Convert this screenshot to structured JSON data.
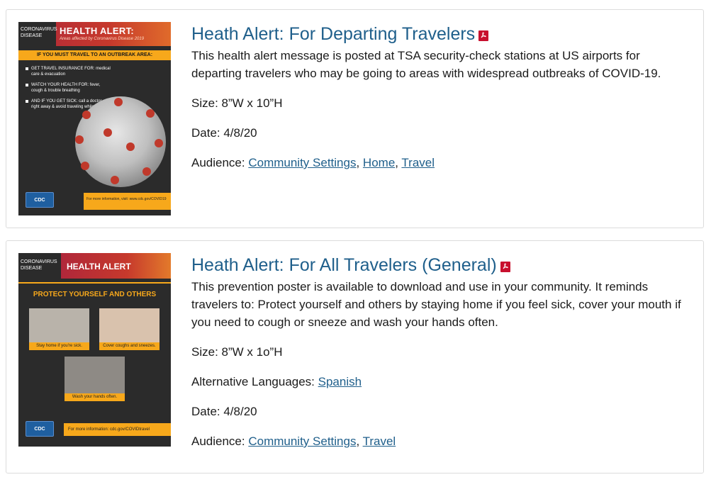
{
  "items": [
    {
      "title": "Heath Alert: For Departing Travelers",
      "description": "This health alert message is posted at TSA security-check stations at US airports for departing travelers who may be going to areas with widespread outbreaks of COVID-19.",
      "size_label": "Size: 8”W x 10”H",
      "date_label": "Date: 4/8/20",
      "audience_label": "Audience: ",
      "audience_links": [
        "Community Settings",
        "Home",
        "Travel"
      ],
      "poster": {
        "corner": "CORONAVIRUS DISEASE",
        "header": "HEALTH ALERT:",
        "subheader": "Areas affected by Coronavirus Disease 2019",
        "band": "IF YOU MUST TRAVEL TO AN OUTBREAK AREA:",
        "bullets": [
          "GET TRAVEL INSURANCE FOR: medical care & evacuation",
          "WATCH YOUR HEALTH FOR: fever, cough & trouble breathing",
          "AND IF YOU GET SICK: call a doctor right away & avoid traveling while sick"
        ],
        "footer": "For more information, visit: www.cdc.gov/COVID19",
        "logo": "CDC"
      }
    },
    {
      "title": "Heath Alert: For All Travelers (General)",
      "description": "This prevention poster is available to download and use in your community. It reminds travelers to: Protect yourself and others by staying home if you feel sick, cover your mouth if you need to cough or sneeze and wash your hands often.",
      "size_label": "Size: 8”W x 1o”H",
      "alt_lang_label": "Alternative Languages: ",
      "alt_lang_link": "Spanish",
      "date_label": "Date: 4/8/20",
      "audience_label": "Audience: ",
      "audience_links": [
        "Community Settings",
        "Travel"
      ],
      "poster": {
        "corner": "CORONAVIRUS DISEASE",
        "header": "HEALTH ALERT",
        "heading": "PROTECT YOURSELF AND OTHERS",
        "captions": [
          "Stay home if you're sick.",
          "Cover coughs and sneezes.",
          "Wash your hands often."
        ],
        "footer": "For more information: cdc.gov/COVIDtravel",
        "logo": "CDC"
      }
    }
  ],
  "colors": {
    "link": "#1f5f8b",
    "pdf_icon": "#c8102e",
    "accent": "#f7a81b"
  }
}
